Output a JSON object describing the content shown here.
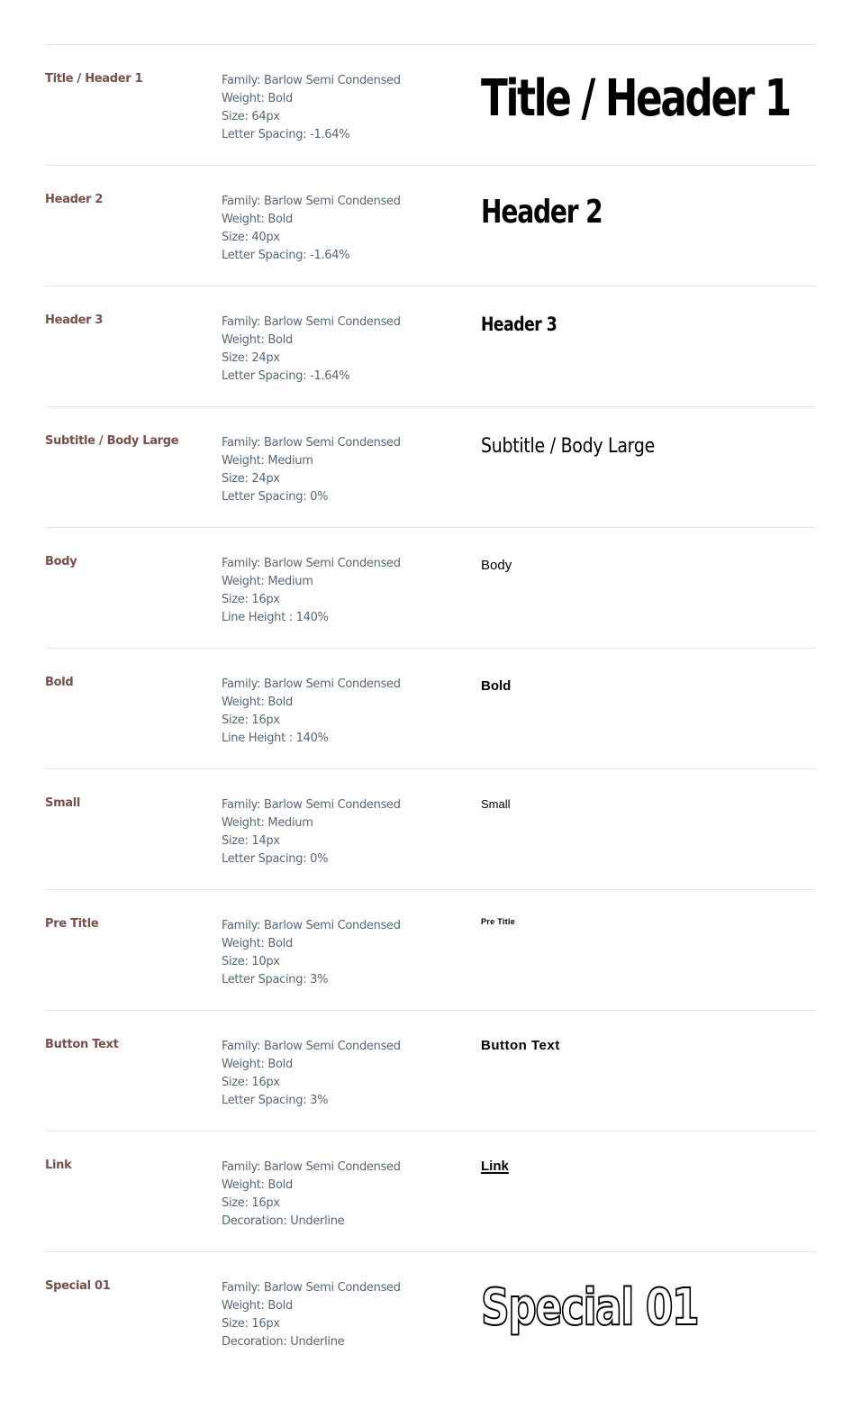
{
  "rows": [
    {
      "name": "Title / Header 1",
      "specs": [
        "Family: Barlow Semi Condensed",
        "Weight: Bold",
        "Size: 64px",
        "Letter Spacing: -1.64%"
      ],
      "sample": "Title / Header 1"
    },
    {
      "name": "Header 2",
      "specs": [
        "Family: Barlow Semi Condensed",
        "Weight: Bold",
        "Size: 40px",
        "Letter Spacing: -1.64%"
      ],
      "sample": "Header 2"
    },
    {
      "name": "Header 3",
      "specs": [
        "Family: Barlow Semi Condensed",
        "Weight: Bold",
        "Size: 24px",
        "Letter Spacing: -1.64%"
      ],
      "sample": "Header 3"
    },
    {
      "name": "Subtitle / Body Large",
      "specs": [
        "Family: Barlow Semi Condensed",
        "Weight: Medium",
        "Size: 24px",
        "Letter Spacing: 0%"
      ],
      "sample": "Subtitle / Body Large"
    },
    {
      "name": "Body",
      "specs": [
        "Family: Barlow Semi Condensed",
        "Weight: Medium",
        "Size: 16px",
        "Line Height : 140%"
      ],
      "sample": "Body"
    },
    {
      "name": "Bold",
      "specs": [
        "Family: Barlow Semi Condensed",
        "Weight: Bold",
        "Size: 16px",
        "Line Height : 140%"
      ],
      "sample": "Bold"
    },
    {
      "name": "Small",
      "specs": [
        "Family: Barlow Semi Condensed",
        "Weight: Medium",
        "Size: 14px",
        "Letter Spacing: 0%"
      ],
      "sample": "Small"
    },
    {
      "name": "Pre Title",
      "specs": [
        "Family: Barlow Semi Condensed",
        "Weight: Bold",
        "Size: 10px",
        "Letter Spacing: 3%"
      ],
      "sample": "Pre Title"
    },
    {
      "name": "Button Text",
      "specs": [
        "Family: Barlow Semi Condensed",
        "Weight: Bold",
        "Size: 16px",
        "Letter Spacing: 3%"
      ],
      "sample": "Button Text"
    },
    {
      "name": "Link",
      "specs": [
        "Family: Barlow Semi Condensed",
        "Weight: Bold",
        "Size: 16px",
        "Decoration: Underline"
      ],
      "sample": "Link"
    },
    {
      "name": "Special 01",
      "specs": [
        "Family: Barlow Semi Condensed",
        "Weight: Bold",
        "Size: 16px",
        "Decoration: Underline"
      ],
      "sample": "Special 01"
    }
  ],
  "colors": {
    "style_name": "#7a4f4b",
    "spec_text": "#56677a",
    "sample_text": "#000000",
    "divider": "#e4e4e4"
  }
}
